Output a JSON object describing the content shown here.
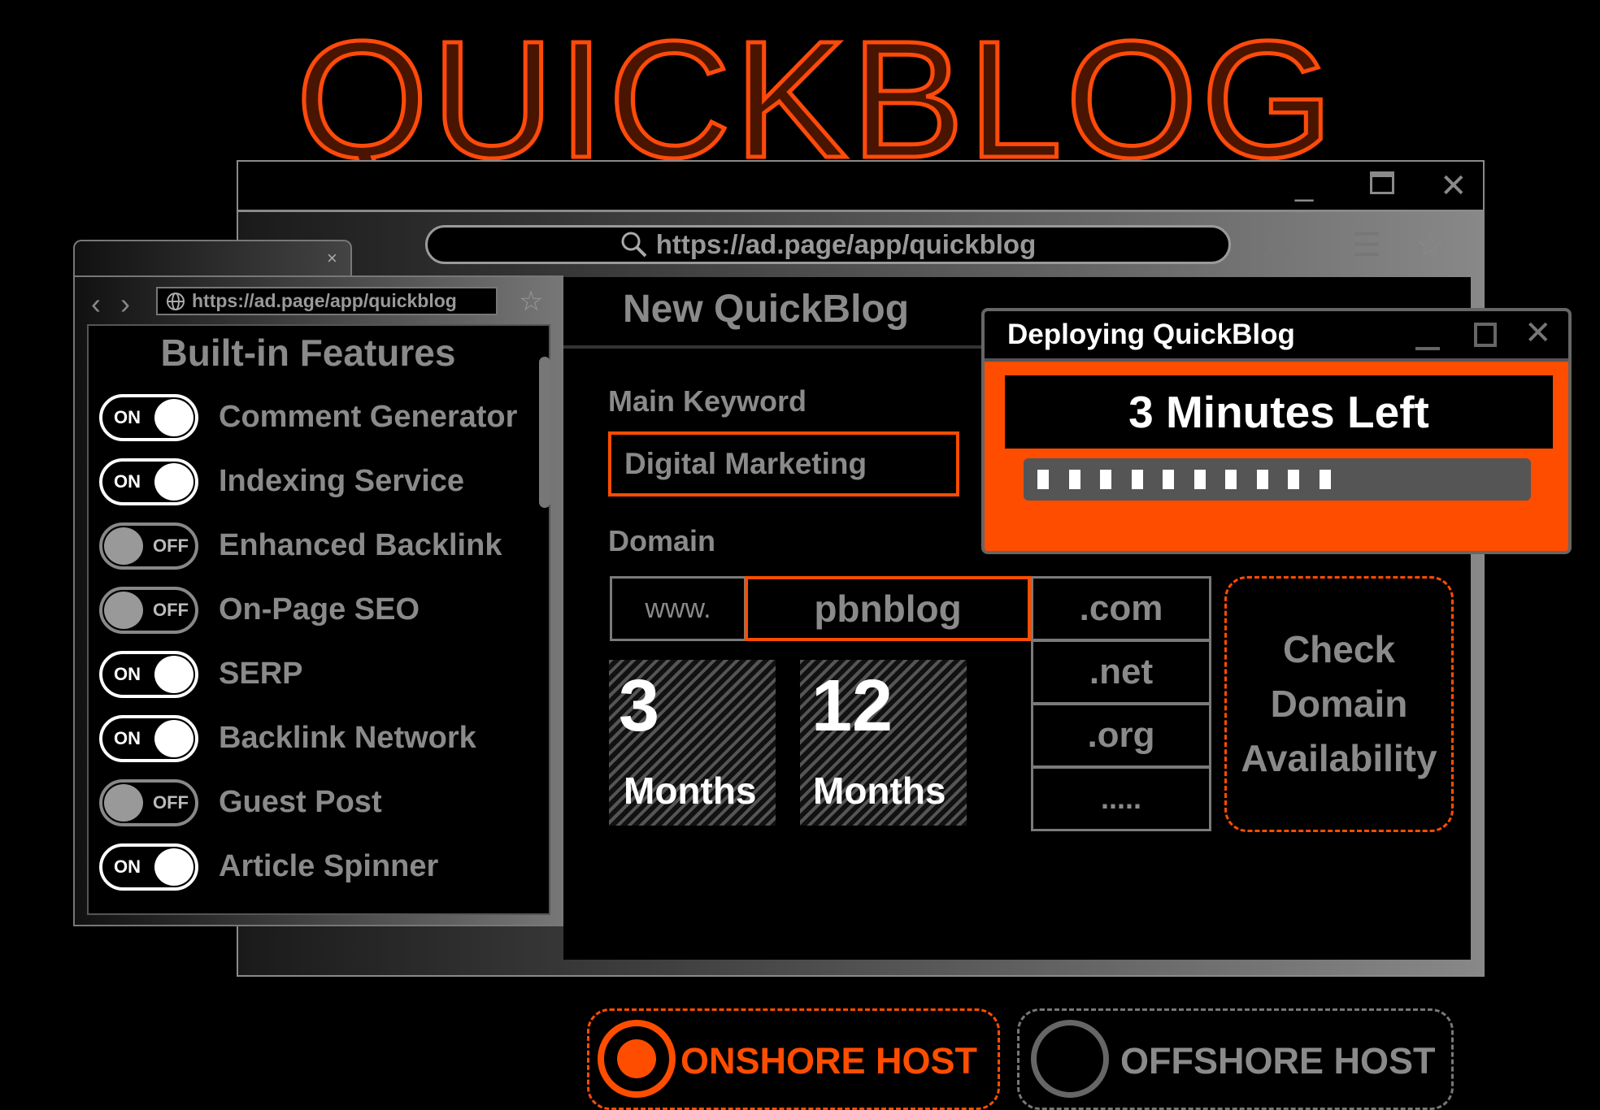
{
  "logo": "QUICKBLOG",
  "colors": {
    "accent": "#ff4d00",
    "muted": "#8a8a8a"
  },
  "main_window": {
    "controls": {
      "minimize": "_",
      "maximize": "maximize-icon",
      "close": "close-icon"
    },
    "url": "https://ad.page/app/quickblog",
    "page_title": "New QuickBlog",
    "keyword_label": "Main Keyword",
    "keyword_value": "Digital Marketing",
    "domain_label": "Domain",
    "domain_prefix": "www.",
    "domain_name": "pbnblog",
    "tlds": [
      ".com",
      ".net",
      ".org",
      "....."
    ],
    "plans": [
      {
        "number": "3",
        "unit": "Months"
      },
      {
        "number": "12",
        "unit": "Months"
      }
    ],
    "check_button": "Check Domain Availability",
    "hosting": [
      {
        "label": "ONSHORE HOST",
        "selected": true
      },
      {
        "label": "OFFSHORE HOST",
        "selected": false
      }
    ]
  },
  "features_window": {
    "url": "https://ad.page/app/quickblog",
    "title": "Built-in Features",
    "features": [
      {
        "label": "Comment Generator",
        "state": "ON"
      },
      {
        "label": "Indexing Service",
        "state": "ON"
      },
      {
        "label": "Enhanced Backlink",
        "state": "OFF"
      },
      {
        "label": "On-Page SEO",
        "state": "OFF"
      },
      {
        "label": "SERP",
        "state": "ON"
      },
      {
        "label": "Backlink Network",
        "state": "ON"
      },
      {
        "label": "Guest Post",
        "state": "OFF"
      },
      {
        "label": "Article Spinner",
        "state": "ON"
      }
    ]
  },
  "deploy_dialog": {
    "title": "Deploying QuickBlog",
    "status": "3 Minutes Left",
    "progress": 0.6,
    "segments_filled": 10
  }
}
